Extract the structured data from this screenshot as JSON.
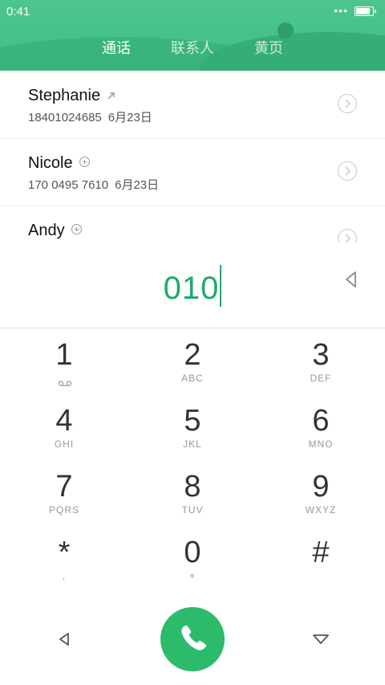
{
  "status_bar": {
    "time": "0:41",
    "dots": "•••"
  },
  "tabs": [
    {
      "label": "通话",
      "active": true
    },
    {
      "label": "联系人",
      "active": false
    },
    {
      "label": "黄页",
      "active": false
    }
  ],
  "call_log": [
    {
      "name": "Stephanie",
      "badge": "outgoing-arrow-icon",
      "number": "18401024685",
      "date": "6月23日"
    },
    {
      "name": "Nicole",
      "badge": "add-contact-icon",
      "number": "170 0495 7610",
      "date": "6月23日"
    },
    {
      "name": "Andy",
      "badge": "add-contact-icon",
      "number": "",
      "date": ""
    }
  ],
  "dial_input": {
    "value": "010"
  },
  "keypad": [
    {
      "digit": "1",
      "letters": ""
    },
    {
      "digit": "2",
      "letters": "ABC"
    },
    {
      "digit": "3",
      "letters": "DEF"
    },
    {
      "digit": "4",
      "letters": "GHI"
    },
    {
      "digit": "5",
      "letters": "JKL"
    },
    {
      "digit": "6",
      "letters": "MNO"
    },
    {
      "digit": "7",
      "letters": "PQRS"
    },
    {
      "digit": "8",
      "letters": "TUV"
    },
    {
      "digit": "9",
      "letters": "WXYZ"
    },
    {
      "digit": "*",
      "letters": ","
    },
    {
      "digit": "0",
      "letters": "+"
    },
    {
      "digit": "#",
      "letters": ""
    }
  ],
  "colors": {
    "accent": "#1ea96b",
    "header": "#4dc58d",
    "call_button": "#2bbb6a"
  }
}
